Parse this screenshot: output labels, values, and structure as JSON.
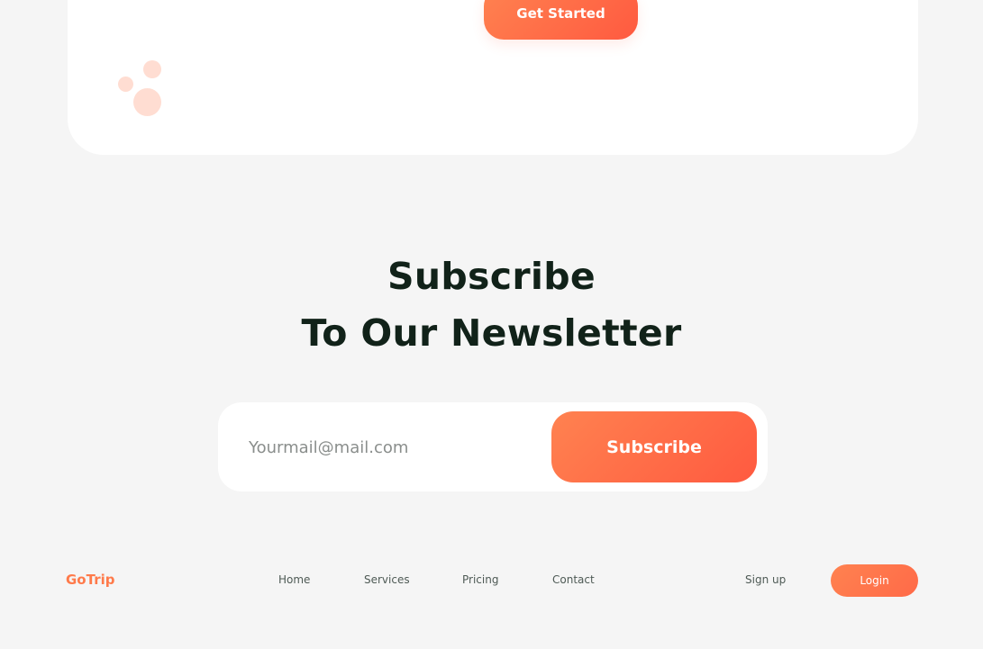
{
  "hero": {
    "cta_label": "Get Started"
  },
  "newsletter": {
    "heading_line1": "Subscribe",
    "heading_line2": "To Our Newsletter",
    "email_placeholder": "Yourmail@mail.com",
    "email_value": "",
    "subscribe_label": "Subscribe"
  },
  "footer": {
    "logo": "GoTrip",
    "nav": {
      "home": "Home",
      "services": "Services",
      "pricing": "Pricing",
      "contact": "Contact"
    },
    "signup_label": "Sign up",
    "login_label": "Login"
  },
  "colors": {
    "accent": "#ff6a48",
    "accent_light": "#ffddd2",
    "heading": "#112219",
    "background": "#f5f5f5"
  }
}
